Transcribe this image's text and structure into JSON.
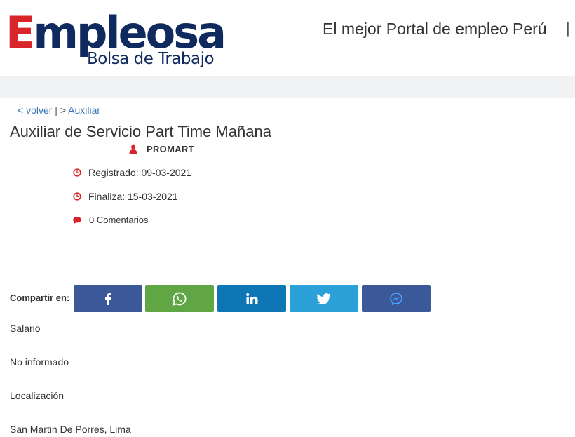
{
  "brand": {
    "logo_letter": "E",
    "logo_rest": "mpleosa",
    "logo_subtitle": "Bolsa de Trabajo",
    "colors": {
      "red": "#d9252a",
      "navy": "#0e2a5e"
    }
  },
  "header": {
    "tagline": "El mejor Portal de empleo Perú",
    "separator": "|"
  },
  "breadcrumb": {
    "back_label": "< volver",
    "separator": " | > ",
    "category_label": "Auxiliar"
  },
  "job": {
    "title": "Auxiliar de Servicio Part Time Mañana",
    "company": "PROMART",
    "registered": "Registrado: 09-03-2021",
    "ends": "Finaliza: 15-03-2021",
    "comments": "0 Comentarios"
  },
  "share": {
    "label": "Compartir en:",
    "buttons": [
      {
        "icon": "facebook-icon",
        "color": "#3b5998"
      },
      {
        "icon": "whatsapp-icon",
        "color": "#60a645"
      },
      {
        "icon": "linkedin-icon",
        "color": "#0e76b4"
      },
      {
        "icon": "twitter-icon",
        "color": "#2ca0d9"
      },
      {
        "icon": "messenger-icon",
        "color": "#3b5998"
      }
    ]
  },
  "details": {
    "salary_label": "Salario",
    "salary_value": "No informado",
    "location_label": "Localización",
    "location_value": "San Martin De Porres, Lima"
  },
  "accent_icon_color": "#d9252a"
}
